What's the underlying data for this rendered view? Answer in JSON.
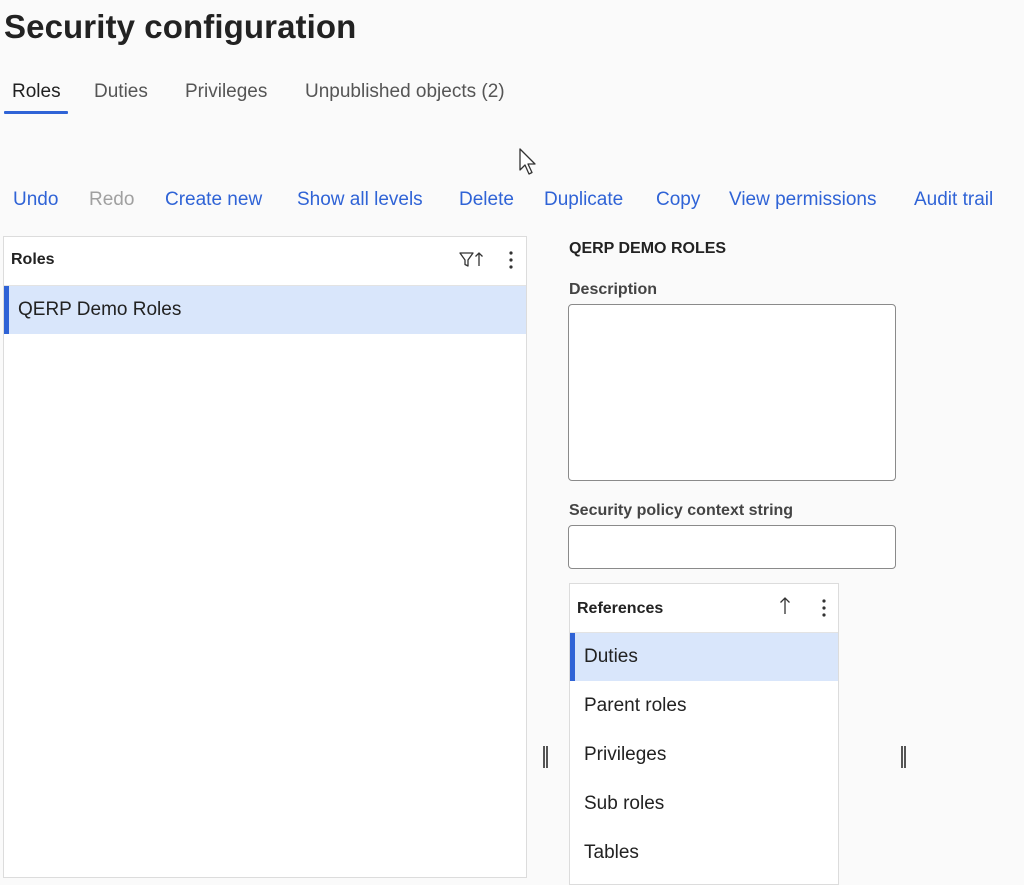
{
  "page": {
    "title": "Security configuration"
  },
  "tabs": [
    {
      "label": "Roles",
      "active": true
    },
    {
      "label": "Duties",
      "active": false
    },
    {
      "label": "Privileges",
      "active": false
    },
    {
      "label": "Unpublished objects (2)",
      "active": false
    }
  ],
  "toolbar": {
    "undo": "Undo",
    "redo": "Redo",
    "create_new": "Create new",
    "show_all_levels": "Show all levels",
    "delete": "Delete",
    "duplicate": "Duplicate",
    "copy": "Copy",
    "view_permissions": "View permissions",
    "audit_trail": "Audit trail"
  },
  "roles_grid": {
    "header": "Roles",
    "rows": [
      {
        "label": "QERP Demo Roles",
        "selected": true
      }
    ]
  },
  "details": {
    "title": "QERP DEMO ROLES",
    "description_label": "Description",
    "description_value": "",
    "context_label": "Security policy context string",
    "context_value": ""
  },
  "references": {
    "header": "References",
    "items": [
      {
        "label": "Duties",
        "selected": true
      },
      {
        "label": "Parent roles",
        "selected": false
      },
      {
        "label": "Privileges",
        "selected": false
      },
      {
        "label": "Sub roles",
        "selected": false
      },
      {
        "label": "Tables",
        "selected": false
      }
    ]
  },
  "colors": {
    "accent": "#2f63d6",
    "selected_row": "#d9e6fb",
    "disabled": "#a0a0a0"
  }
}
